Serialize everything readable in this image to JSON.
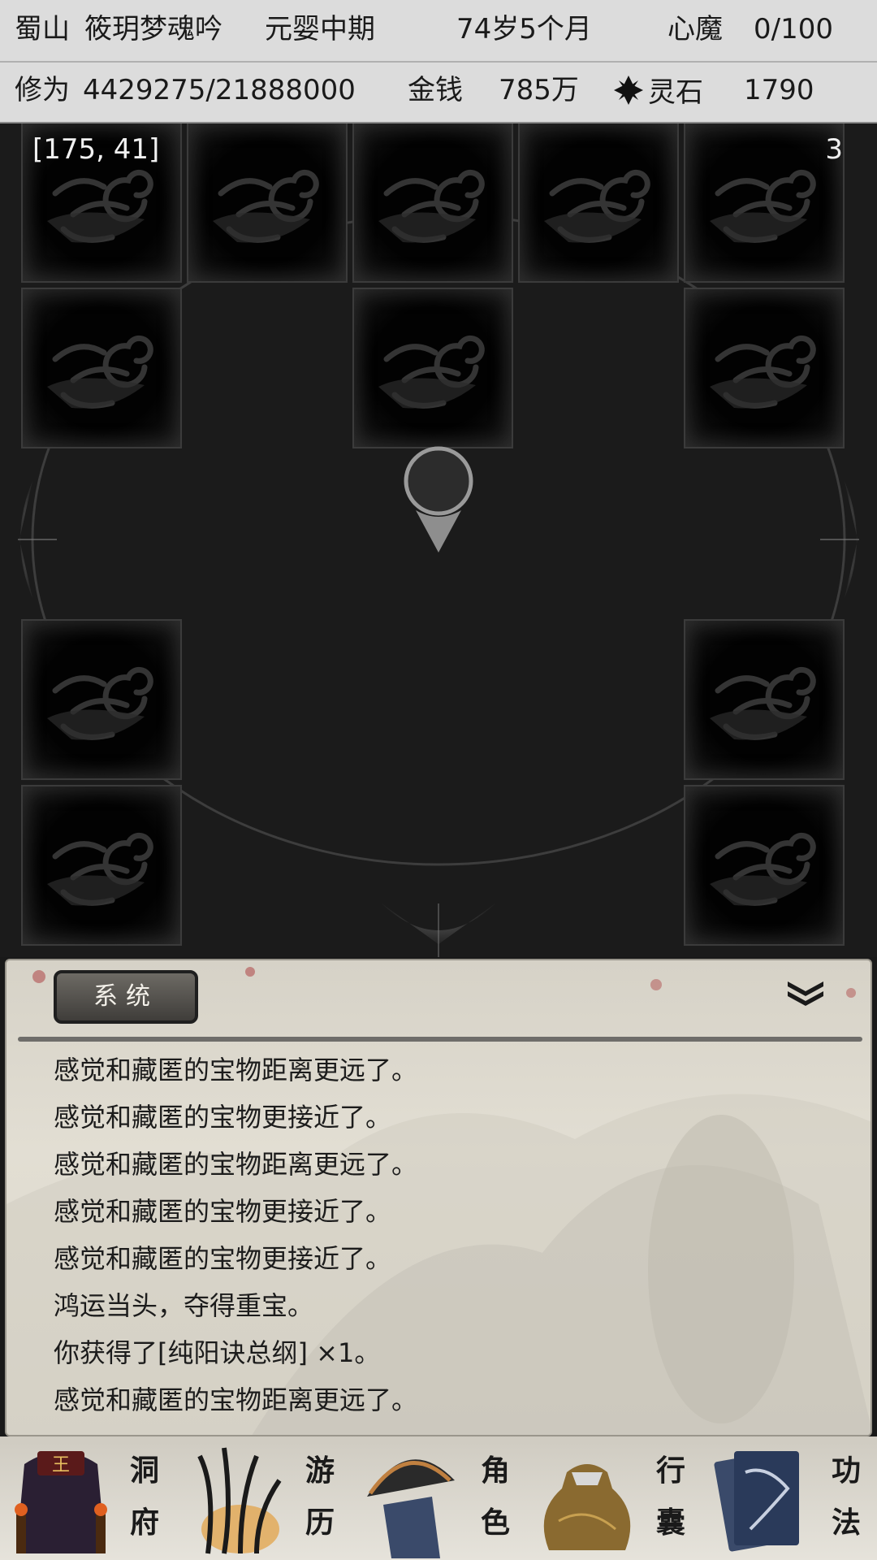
{
  "status": {
    "sect": "蜀山",
    "name": "筱玥梦魂吟",
    "realm": "元婴中期",
    "age": "74岁5个月",
    "demon_label": "心魔",
    "demon_value": "0/100",
    "cultivation_label": "修为",
    "cultivation_value": "4429275/21888000",
    "money_label": "金钱",
    "money_value": "785万",
    "spirit_stone_label": "灵石",
    "spirit_stone_value": "1790"
  },
  "map": {
    "coordinates": "[175, 41]",
    "counter": "3"
  },
  "log": {
    "tab_label": "系统",
    "lines": [
      "感觉和藏匿的宝物距离更远了。",
      "感觉和藏匿的宝物更接近了。",
      "感觉和藏匿的宝物距离更远了。",
      "感觉和藏匿的宝物更接近了。",
      "感觉和藏匿的宝物更接近了。",
      "鸿运当头，夺得重宝。",
      "你获得了[纯阳诀总纲] ×1。",
      "感觉和藏匿的宝物距离更远了。"
    ]
  },
  "nav": [
    {
      "top": "洞",
      "bottom": "府",
      "icon": "cave-dwelling-icon"
    },
    {
      "top": "游",
      "bottom": "历",
      "icon": "grass-travel-icon"
    },
    {
      "top": "角",
      "bottom": "色",
      "icon": "straw-hat-character-icon"
    },
    {
      "top": "行",
      "bottom": "囊",
      "icon": "bag-inventory-icon"
    },
    {
      "top": "功",
      "bottom": "法",
      "icon": "scroll-book-icon"
    }
  ],
  "colors": {
    "map_background": "#1b1b1b",
    "status_background": "#dcdcdc",
    "log_background": "#dedad0"
  }
}
